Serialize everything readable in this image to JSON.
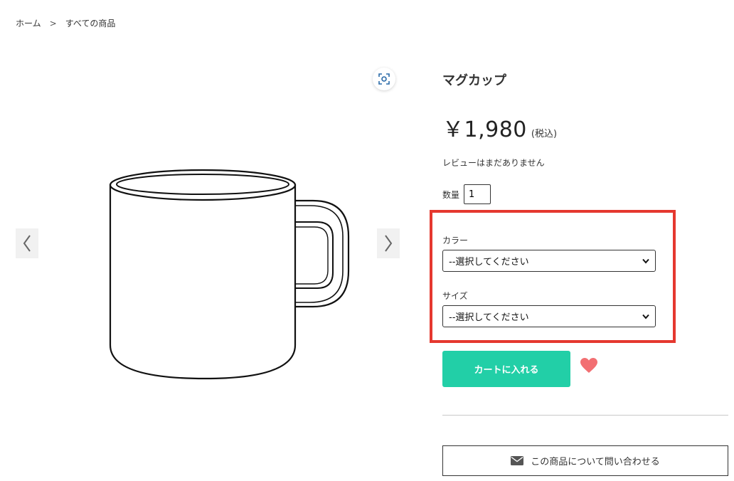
{
  "breadcrumb": {
    "home": "ホーム",
    "separator": ">",
    "current": "すべての商品"
  },
  "gallery": {
    "zoom_icon": "zoom-scan-icon",
    "prev_icon": "chevron-left-icon",
    "next_icon": "chevron-right-icon"
  },
  "product": {
    "title": "マグカップ",
    "price": "￥1,980",
    "tax_note": "(税込)",
    "review_text": "レビューはまだありません"
  },
  "quantity": {
    "label": "数量",
    "value": "1"
  },
  "options": {
    "color": {
      "label": "カラー",
      "selected": "--選択してください"
    },
    "size": {
      "label": "サイズ",
      "selected": "--選択してください"
    },
    "highlight_color": "#e5382f"
  },
  "actions": {
    "add_to_cart": "カートに入れる",
    "cart_color": "#22cfa7",
    "favorite_icon": "heart-icon",
    "favorite_color": "#f26f72",
    "contact": "この商品について問い合わせる",
    "contact_icon": "envelope-icon"
  }
}
